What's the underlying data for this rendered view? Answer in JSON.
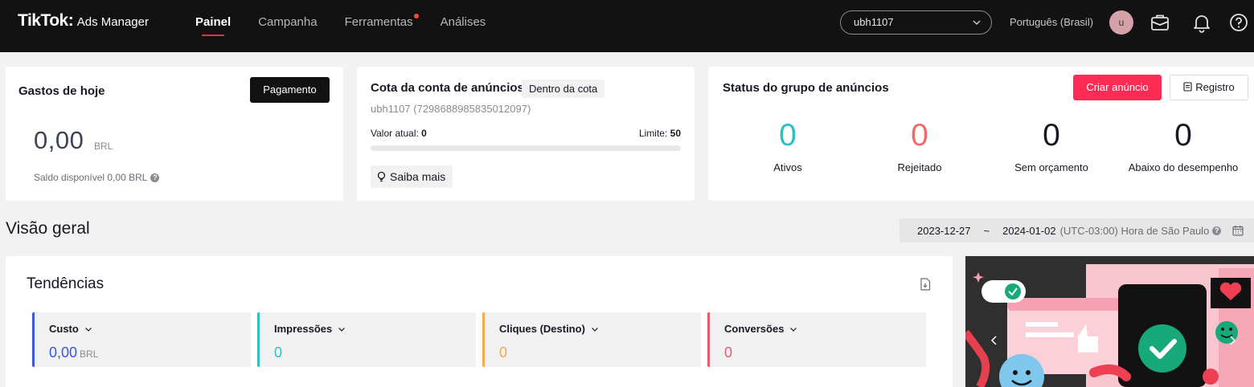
{
  "topbar": {
    "logo_brand": "TikTok",
    "logo_dot": ":",
    "logo_product": "Ads Manager",
    "nav": [
      {
        "label": "Painel",
        "active": true
      },
      {
        "label": "Campanha",
        "active": false
      },
      {
        "label": "Ferramentas",
        "active": false,
        "dot": true
      },
      {
        "label": "Análises",
        "active": false
      }
    ],
    "account": "ubh1107",
    "language": "Português (Brasil)",
    "avatar_initial": "u",
    "icons": [
      "briefcase-icon",
      "bell-icon",
      "help-icon"
    ]
  },
  "spend": {
    "title": "Gastos de hoje",
    "pay_label": "Pagamento",
    "amount": "0,00",
    "currency": "BRL",
    "balance_label": "Saldo disponível 0,00 BRL"
  },
  "quota": {
    "title": "Cota da conta de anúncios",
    "badge": "Dentro da cota",
    "account_id": "ubh1107 (7298688985835012097)",
    "current_label": "Valor atual: ",
    "current_value": "0",
    "limit_label": "Limite: ",
    "limit_value": "50",
    "progress": 0,
    "learn_more": "Saiba mais"
  },
  "status": {
    "title": "Status do grupo de anúncios",
    "create_label": "Criar anúncio",
    "log_label": "Registro",
    "stats": [
      {
        "value": "0",
        "label": "Ativos",
        "color": "#2dc0c6"
      },
      {
        "value": "0",
        "label": "Rejeitado",
        "color": "#f06a6a"
      },
      {
        "value": "0",
        "label": "Sem orçamento",
        "color": "#161823"
      },
      {
        "value": "0",
        "label": "Abaixo do desempenho",
        "color": "#161823"
      }
    ]
  },
  "overview": {
    "title": "Visão geral",
    "date_start": "2023-12-27",
    "date_sep": "~",
    "date_end": "2024-01-02",
    "timezone": "(UTC-03:00) Hora de São Paulo"
  },
  "trends": {
    "title": "Tendências",
    "metrics": [
      {
        "name": "Custo",
        "value": "0,00",
        "unit": "BRL",
        "color": "#3857e2"
      },
      {
        "name": "Impressões",
        "value": "0",
        "unit": "",
        "color": "#2dc0c6"
      },
      {
        "name": "Cliques (Destino)",
        "value": "0",
        "unit": "",
        "color": "#f7a744"
      },
      {
        "name": "Conversões",
        "value": "0",
        "unit": "",
        "color": "#e85a73"
      }
    ]
  },
  "colors": {
    "brand": "#fe2c55",
    "topbar": "#121212"
  }
}
